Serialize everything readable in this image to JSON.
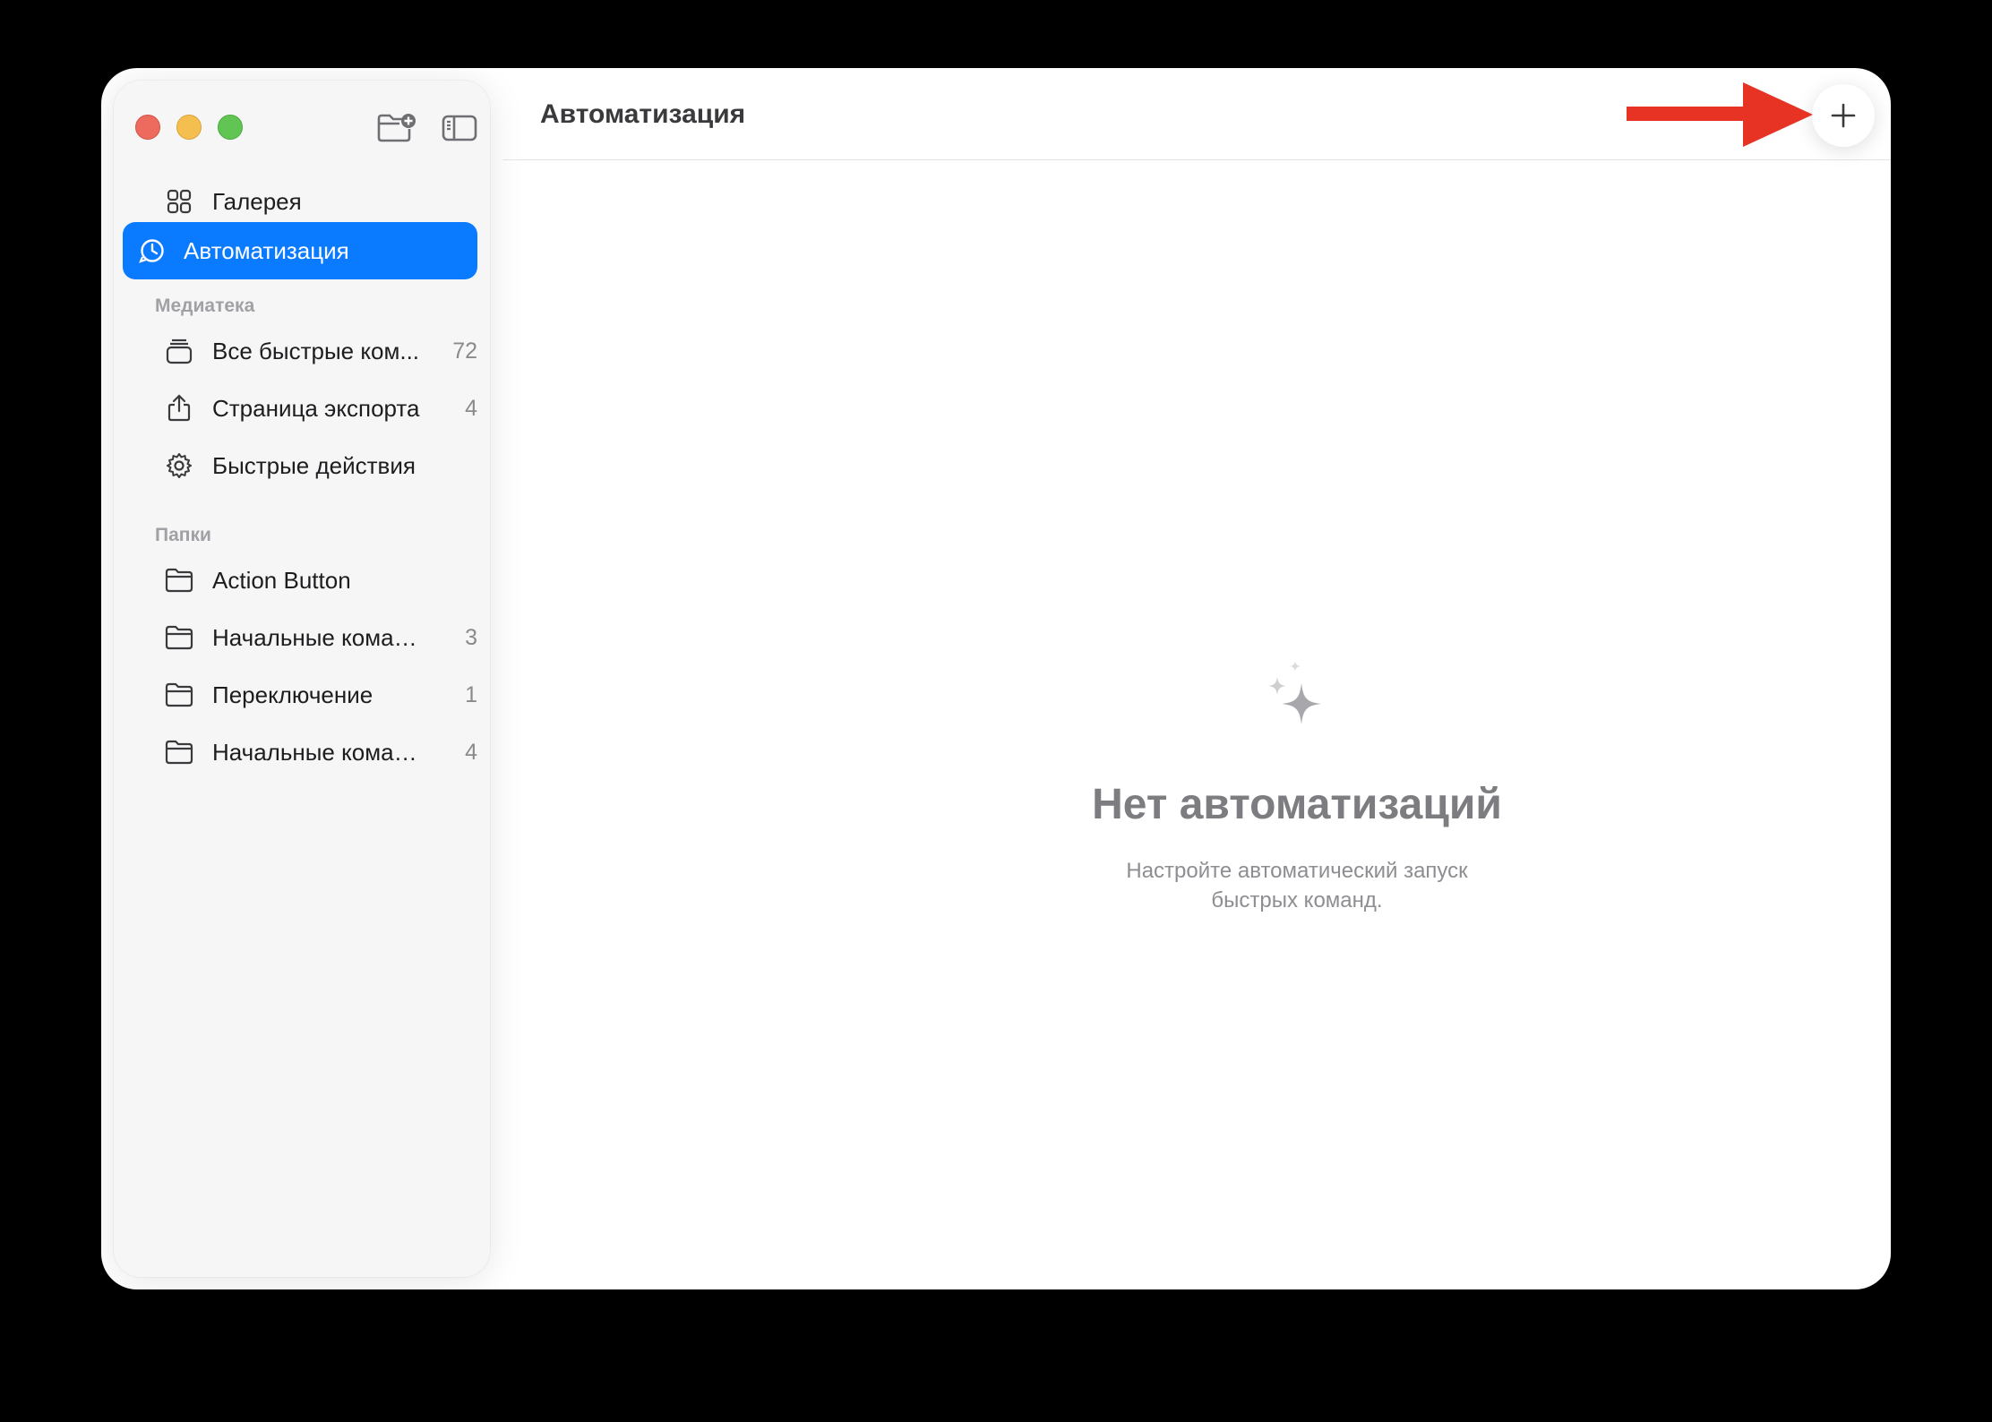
{
  "window": {
    "title": "Автоматизация"
  },
  "sidebar": {
    "top_items": [
      {
        "label": "Галерея",
        "icon": "grid-icon"
      },
      {
        "label": "Автоматизация",
        "icon": "clock-icon",
        "active": true
      }
    ],
    "library_header": "Медиатека",
    "library_items": [
      {
        "label": "Все быстрые ком...",
        "count": "72",
        "icon": "stack-icon"
      },
      {
        "label": "Страница экспорта",
        "count": "4",
        "icon": "share-icon"
      },
      {
        "label": "Быстрые действия",
        "count": "",
        "icon": "gear-icon"
      }
    ],
    "folders_header": "Папки",
    "folder_items": [
      {
        "label": "Action Button",
        "count": "",
        "icon": "folder-icon"
      },
      {
        "label": "Начальные команды",
        "count": "3",
        "icon": "folder-icon"
      },
      {
        "label": "Переключение",
        "count": "1",
        "icon": "folder-icon"
      },
      {
        "label": "Начальные команды",
        "count": "4",
        "icon": "folder-icon"
      }
    ]
  },
  "empty_state": {
    "title": "Нет автоматизаций",
    "subtitle_line1": "Настройте автоматический запуск",
    "subtitle_line2": "быстрых команд.",
    "icon": "sparkles-icon"
  },
  "colors": {
    "accent": "#0a7aff",
    "annotation_arrow": "#e63323"
  }
}
